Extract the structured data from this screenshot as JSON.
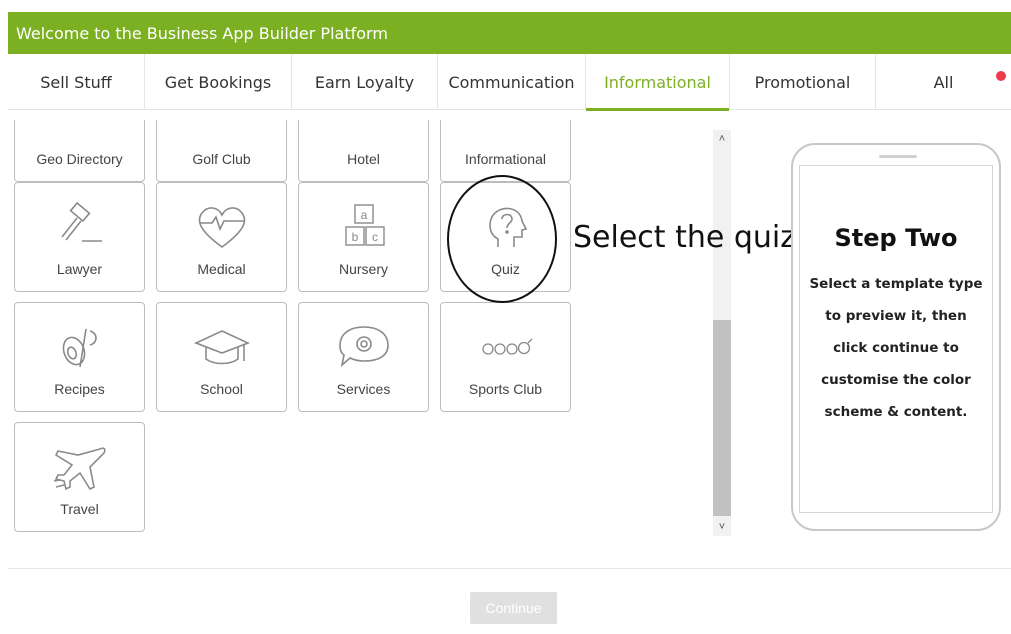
{
  "header": {
    "title": "Welcome to the Business App Builder Platform"
  },
  "tabs": [
    {
      "label": "Sell Stuff"
    },
    {
      "label": "Get Bookings"
    },
    {
      "label": "Earn Loyalty"
    },
    {
      "label": "Communication"
    },
    {
      "label": "Informational",
      "active": true
    },
    {
      "label": "Promotional"
    },
    {
      "label": "All"
    }
  ],
  "tiles_partial": [
    {
      "label": "Geo Directory"
    },
    {
      "label": "Golf Club"
    },
    {
      "label": "Hotel"
    },
    {
      "label": "Informational"
    }
  ],
  "tiles": [
    {
      "label": "Lawyer",
      "icon": "gavel-icon"
    },
    {
      "label": "Medical",
      "icon": "heart-pulse-icon"
    },
    {
      "label": "Nursery",
      "icon": "blocks-icon",
      "blocks": [
        "a",
        "b",
        "c"
      ]
    },
    {
      "label": "Quiz",
      "icon": "head-question-icon"
    },
    {
      "label": "Recipes",
      "icon": "food-icon"
    },
    {
      "label": "School",
      "icon": "graduation-cap-icon"
    },
    {
      "label": "Services",
      "icon": "chat-gear-icon"
    },
    {
      "label": "Sports Club",
      "icon": "sports-balls-icon"
    },
    {
      "label": "Travel",
      "icon": "airplane-icon"
    }
  ],
  "annotation": {
    "text": "Select the quiz"
  },
  "preview": {
    "title": "Step Two",
    "text": "Select a template type to preview it, then click continue to customise the color scheme & content."
  },
  "footer": {
    "continue_label": "Continue"
  },
  "colors": {
    "accent": "#7cb023",
    "notification": "#ee3a4a"
  }
}
